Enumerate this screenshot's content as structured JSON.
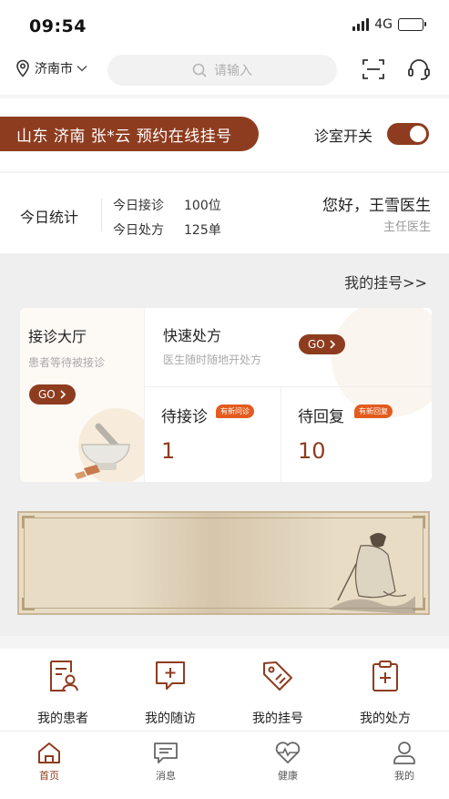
{
  "status_bar": {
    "time": "09:54",
    "network": "4G"
  },
  "header": {
    "city": "济南市",
    "search_placeholder": "请输入"
  },
  "banner": {
    "region_text": "山东 济南 张*云 预约在线挂号",
    "clinic_switch_label": "诊室开关",
    "clinic_switch_on": true
  },
  "stats": {
    "title": "今日统计",
    "visits_label": "今日接诊",
    "visits_value": "100位",
    "prescriptions_label": "今日处方",
    "prescriptions_value": "125单",
    "greeting": "您好，王雪医生",
    "role": "主任医生"
  },
  "my_registration_link": "我的挂号>>",
  "cards": {
    "hall": {
      "title": "接诊大厅",
      "subtitle": "患者等待被接诊",
      "go": "GO"
    },
    "quick": {
      "title": "快速处方",
      "subtitle": "医生随时随地开处方",
      "go": "GO"
    },
    "waiting": {
      "title": "待接诊",
      "badge": "有新问诊",
      "count": "1"
    },
    "reply": {
      "title": "待回复",
      "badge": "有新回复",
      "count": "10"
    }
  },
  "quick_links": [
    {
      "label": "我的患者",
      "icon": "patient-record-icon"
    },
    {
      "label": "我的随访",
      "icon": "follow-up-chat-icon"
    },
    {
      "label": "我的挂号",
      "icon": "tag-icon"
    },
    {
      "label": "我的处方",
      "icon": "clipboard-plus-icon"
    }
  ],
  "tabs": [
    {
      "label": "首页",
      "icon": "home-icon",
      "active": true
    },
    {
      "label": "消息",
      "icon": "message-icon",
      "active": false
    },
    {
      "label": "健康",
      "icon": "heart-pulse-icon",
      "active": false
    },
    {
      "label": "我的",
      "icon": "user-icon",
      "active": false
    }
  ],
  "colors": {
    "brand": "#8e3c1f",
    "badge": "#e35b1e",
    "background_grey": "#efefef"
  }
}
